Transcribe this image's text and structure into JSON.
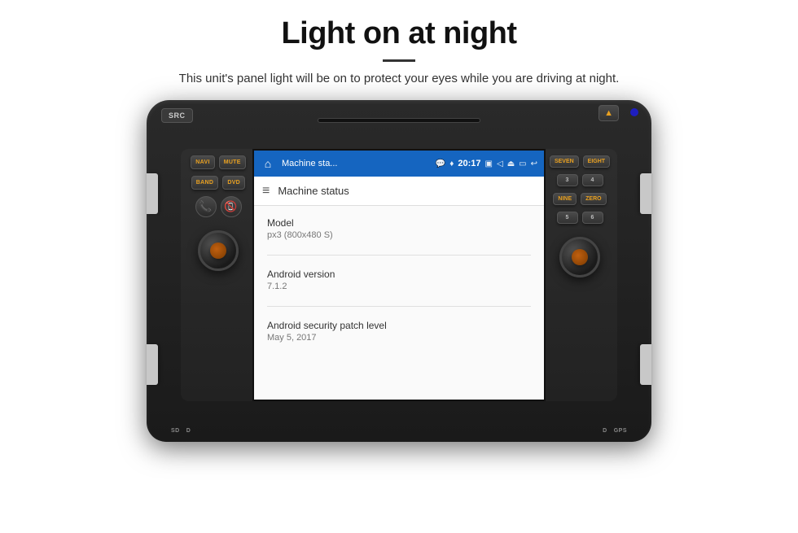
{
  "header": {
    "title": "Light on at night",
    "subtitle": "This unit's panel light will be on to protect your eyes while you are driving at night."
  },
  "unit": {
    "buttons": {
      "src": "SRC",
      "navi": "NAVI",
      "mute": "MUTE",
      "band": "BAND",
      "dvd": "DVD",
      "seven": "SEVEN",
      "eight": "EIGHT",
      "nine": "NINE",
      "zero": "ZERO"
    },
    "bottom_labels": {
      "left1": "SD",
      "left2": "D",
      "right1": "D",
      "right2": "GPS"
    }
  },
  "screen": {
    "status_bar": {
      "app_title": "Machine sta...",
      "chat_icon": "💬",
      "location_icon": "♦",
      "time": "20:17",
      "media_icon": "▣",
      "volume_icon": "◁",
      "eject_icon": "⏏",
      "screen_icon": "▭",
      "back_icon": "↩",
      "reply_icon": "↶"
    },
    "app_bar": {
      "title": "Machine status"
    },
    "info_items": [
      {
        "label": "Model",
        "value": "px3 (800x480 S)"
      },
      {
        "label": "Android version",
        "value": "7.1.2"
      },
      {
        "label": "Android security patch level",
        "value": "May 5, 2017"
      }
    ]
  }
}
